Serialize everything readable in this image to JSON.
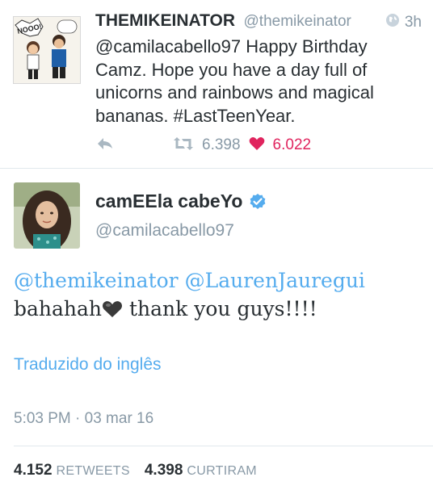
{
  "tweet1": {
    "name": "THEMIKEINATOR",
    "handle": "@themikeinator",
    "time": "3h",
    "avatar_text": "NOOO!",
    "text_mention": "@camilacabello97",
    "text_rest": " Happy Birthday Camz. Hope you have a day full of unicorns  and rainbows and magical bananas. #LastTeenYear.",
    "retweets": "6.398",
    "likes": "6.022",
    "icons": [
      "globe-icon",
      "reply-icon",
      "retweet-icon",
      "heart-icon"
    ]
  },
  "tweet2": {
    "name": "camEEla cabeYo",
    "handle": "@camilacabello97",
    "mention1": "@themikeinator",
    "mention2": "@LaurenJauregui",
    "text_before_emoji": "bahahah",
    "text_after_emoji": " thank you guys!!!!",
    "translate_label": "Traduzido do inglês",
    "timestamp": "5:03 PM · 03 mar 16",
    "retweets_count": "4.152",
    "retweets_label": "RETWEETS",
    "likes_count": "4.398",
    "likes_label": "CURTIRAM",
    "icons": [
      "verified-badge-icon",
      "black-heart-emoji-icon"
    ]
  },
  "colors": {
    "link": "#55acee",
    "like": "#e0245e",
    "muted": "#8899a6",
    "text": "#292f33"
  }
}
